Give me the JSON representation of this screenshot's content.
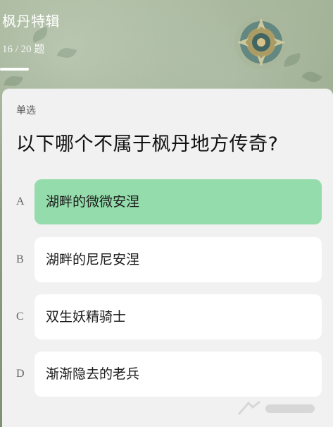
{
  "header": {
    "title": "枫丹特辑",
    "progress_text": "16 / 20 题",
    "progress_fraction": 0.8
  },
  "question": {
    "type_label": "单选",
    "text": "以下哪个不属于枫丹地方传奇?"
  },
  "options": [
    {
      "letter": "A",
      "text": "湖畔的微微安涅",
      "selected": true
    },
    {
      "letter": "B",
      "text": "湖畔的尼尼安涅",
      "selected": false
    },
    {
      "letter": "C",
      "text": "双生妖精骑士",
      "selected": false
    },
    {
      "letter": "D",
      "text": "渐渐隐去的老兵",
      "selected": false
    }
  ],
  "colors": {
    "selected_option": "#94dcab",
    "option_background": "#ffffff",
    "card_background": "#f1f1f1",
    "header_text": "#ffffff"
  },
  "icons": {
    "emblem": "fontaine-emblem-icon"
  }
}
